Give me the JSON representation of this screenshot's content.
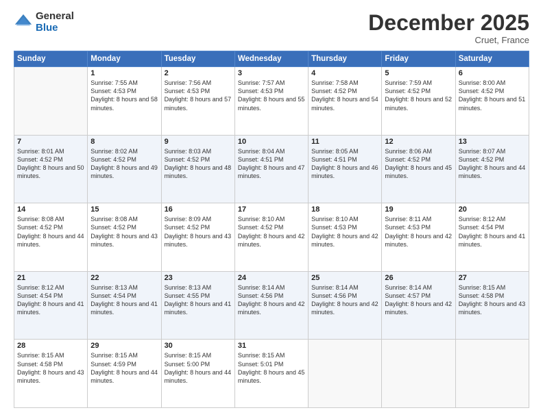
{
  "logo": {
    "general": "General",
    "blue": "Blue"
  },
  "title": "December 2025",
  "location": "Cruet, France",
  "days_of_week": [
    "Sunday",
    "Monday",
    "Tuesday",
    "Wednesday",
    "Thursday",
    "Friday",
    "Saturday"
  ],
  "weeks": [
    [
      {
        "day": "",
        "sunrise": "",
        "sunset": "",
        "daylight": ""
      },
      {
        "day": "1",
        "sunrise": "Sunrise: 7:55 AM",
        "sunset": "Sunset: 4:53 PM",
        "daylight": "Daylight: 8 hours and 58 minutes."
      },
      {
        "day": "2",
        "sunrise": "Sunrise: 7:56 AM",
        "sunset": "Sunset: 4:53 PM",
        "daylight": "Daylight: 8 hours and 57 minutes."
      },
      {
        "day": "3",
        "sunrise": "Sunrise: 7:57 AM",
        "sunset": "Sunset: 4:53 PM",
        "daylight": "Daylight: 8 hours and 55 minutes."
      },
      {
        "day": "4",
        "sunrise": "Sunrise: 7:58 AM",
        "sunset": "Sunset: 4:52 PM",
        "daylight": "Daylight: 8 hours and 54 minutes."
      },
      {
        "day": "5",
        "sunrise": "Sunrise: 7:59 AM",
        "sunset": "Sunset: 4:52 PM",
        "daylight": "Daylight: 8 hours and 52 minutes."
      },
      {
        "day": "6",
        "sunrise": "Sunrise: 8:00 AM",
        "sunset": "Sunset: 4:52 PM",
        "daylight": "Daylight: 8 hours and 51 minutes."
      }
    ],
    [
      {
        "day": "7",
        "sunrise": "Sunrise: 8:01 AM",
        "sunset": "Sunset: 4:52 PM",
        "daylight": "Daylight: 8 hours and 50 minutes."
      },
      {
        "day": "8",
        "sunrise": "Sunrise: 8:02 AM",
        "sunset": "Sunset: 4:52 PM",
        "daylight": "Daylight: 8 hours and 49 minutes."
      },
      {
        "day": "9",
        "sunrise": "Sunrise: 8:03 AM",
        "sunset": "Sunset: 4:52 PM",
        "daylight": "Daylight: 8 hours and 48 minutes."
      },
      {
        "day": "10",
        "sunrise": "Sunrise: 8:04 AM",
        "sunset": "Sunset: 4:51 PM",
        "daylight": "Daylight: 8 hours and 47 minutes."
      },
      {
        "day": "11",
        "sunrise": "Sunrise: 8:05 AM",
        "sunset": "Sunset: 4:51 PM",
        "daylight": "Daylight: 8 hours and 46 minutes."
      },
      {
        "day": "12",
        "sunrise": "Sunrise: 8:06 AM",
        "sunset": "Sunset: 4:52 PM",
        "daylight": "Daylight: 8 hours and 45 minutes."
      },
      {
        "day": "13",
        "sunrise": "Sunrise: 8:07 AM",
        "sunset": "Sunset: 4:52 PM",
        "daylight": "Daylight: 8 hours and 44 minutes."
      }
    ],
    [
      {
        "day": "14",
        "sunrise": "Sunrise: 8:08 AM",
        "sunset": "Sunset: 4:52 PM",
        "daylight": "Daylight: 8 hours and 44 minutes."
      },
      {
        "day": "15",
        "sunrise": "Sunrise: 8:08 AM",
        "sunset": "Sunset: 4:52 PM",
        "daylight": "Daylight: 8 hours and 43 minutes."
      },
      {
        "day": "16",
        "sunrise": "Sunrise: 8:09 AM",
        "sunset": "Sunset: 4:52 PM",
        "daylight": "Daylight: 8 hours and 43 minutes."
      },
      {
        "day": "17",
        "sunrise": "Sunrise: 8:10 AM",
        "sunset": "Sunset: 4:52 PM",
        "daylight": "Daylight: 8 hours and 42 minutes."
      },
      {
        "day": "18",
        "sunrise": "Sunrise: 8:10 AM",
        "sunset": "Sunset: 4:53 PM",
        "daylight": "Daylight: 8 hours and 42 minutes."
      },
      {
        "day": "19",
        "sunrise": "Sunrise: 8:11 AM",
        "sunset": "Sunset: 4:53 PM",
        "daylight": "Daylight: 8 hours and 42 minutes."
      },
      {
        "day": "20",
        "sunrise": "Sunrise: 8:12 AM",
        "sunset": "Sunset: 4:54 PM",
        "daylight": "Daylight: 8 hours and 41 minutes."
      }
    ],
    [
      {
        "day": "21",
        "sunrise": "Sunrise: 8:12 AM",
        "sunset": "Sunset: 4:54 PM",
        "daylight": "Daylight: 8 hours and 41 minutes."
      },
      {
        "day": "22",
        "sunrise": "Sunrise: 8:13 AM",
        "sunset": "Sunset: 4:54 PM",
        "daylight": "Daylight: 8 hours and 41 minutes."
      },
      {
        "day": "23",
        "sunrise": "Sunrise: 8:13 AM",
        "sunset": "Sunset: 4:55 PM",
        "daylight": "Daylight: 8 hours and 41 minutes."
      },
      {
        "day": "24",
        "sunrise": "Sunrise: 8:14 AM",
        "sunset": "Sunset: 4:56 PM",
        "daylight": "Daylight: 8 hours and 42 minutes."
      },
      {
        "day": "25",
        "sunrise": "Sunrise: 8:14 AM",
        "sunset": "Sunset: 4:56 PM",
        "daylight": "Daylight: 8 hours and 42 minutes."
      },
      {
        "day": "26",
        "sunrise": "Sunrise: 8:14 AM",
        "sunset": "Sunset: 4:57 PM",
        "daylight": "Daylight: 8 hours and 42 minutes."
      },
      {
        "day": "27",
        "sunrise": "Sunrise: 8:15 AM",
        "sunset": "Sunset: 4:58 PM",
        "daylight": "Daylight: 8 hours and 43 minutes."
      }
    ],
    [
      {
        "day": "28",
        "sunrise": "Sunrise: 8:15 AM",
        "sunset": "Sunset: 4:58 PM",
        "daylight": "Daylight: 8 hours and 43 minutes."
      },
      {
        "day": "29",
        "sunrise": "Sunrise: 8:15 AM",
        "sunset": "Sunset: 4:59 PM",
        "daylight": "Daylight: 8 hours and 44 minutes."
      },
      {
        "day": "30",
        "sunrise": "Sunrise: 8:15 AM",
        "sunset": "Sunset: 5:00 PM",
        "daylight": "Daylight: 8 hours and 44 minutes."
      },
      {
        "day": "31",
        "sunrise": "Sunrise: 8:15 AM",
        "sunset": "Sunset: 5:01 PM",
        "daylight": "Daylight: 8 hours and 45 minutes."
      },
      {
        "day": "",
        "sunrise": "",
        "sunset": "",
        "daylight": ""
      },
      {
        "day": "",
        "sunrise": "",
        "sunset": "",
        "daylight": ""
      },
      {
        "day": "",
        "sunrise": "",
        "sunset": "",
        "daylight": ""
      }
    ]
  ]
}
